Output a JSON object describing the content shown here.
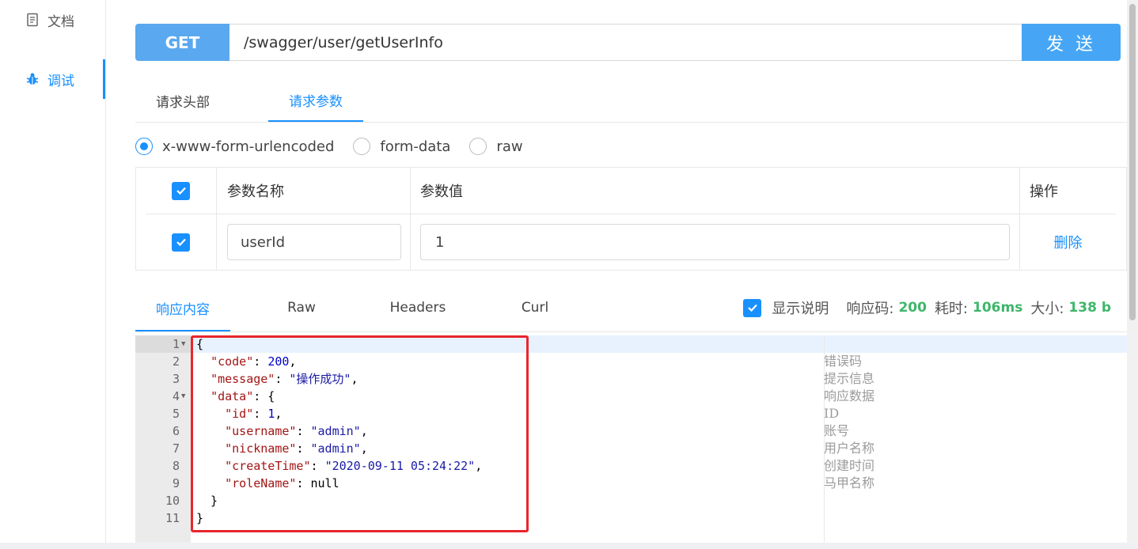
{
  "sidebar": {
    "items": [
      {
        "label": "文档",
        "icon": "document-icon"
      },
      {
        "label": "调试",
        "icon": "bug-icon"
      }
    ]
  },
  "request": {
    "method": "GET",
    "url": "/swagger/user/getUserInfo",
    "send_label": "发 送"
  },
  "tabs": [
    {
      "label": "请求头部"
    },
    {
      "label": "请求参数"
    }
  ],
  "body_types": [
    {
      "label": "x-www-form-urlencoded",
      "selected": true
    },
    {
      "label": "form-data",
      "selected": false
    },
    {
      "label": "raw",
      "selected": false
    }
  ],
  "params_table": {
    "headers": [
      "参数名称",
      "参数值",
      "操作"
    ],
    "rows": [
      {
        "checked": true,
        "name": "userId",
        "value": "1",
        "action": "删除"
      }
    ]
  },
  "response_tabs": [
    {
      "label": "响应内容"
    },
    {
      "label": "Raw"
    },
    {
      "label": "Headers"
    },
    {
      "label": "Curl"
    }
  ],
  "response_meta": {
    "show_desc_label": "显示说明",
    "show_desc_checked": true,
    "status_label": "响应码:",
    "status_value": "200",
    "time_label": "耗时:",
    "time_value": "106ms",
    "size_label": "大小:",
    "size_value": "138 b"
  },
  "response_code": {
    "lines": [
      {
        "n": "1",
        "fold": true
      },
      {
        "n": "2",
        "fold": false
      },
      {
        "n": "3",
        "fold": false
      },
      {
        "n": "4",
        "fold": true
      },
      {
        "n": "5",
        "fold": false
      },
      {
        "n": "6",
        "fold": false
      },
      {
        "n": "7",
        "fold": false
      },
      {
        "n": "8",
        "fold": false
      },
      {
        "n": "9",
        "fold": false
      },
      {
        "n": "10",
        "fold": false
      },
      {
        "n": "11",
        "fold": false
      }
    ],
    "keys": {
      "code": "\"code\"",
      "message": "\"message\"",
      "data": "\"data\"",
      "id": "\"id\"",
      "username": "\"username\"",
      "nickname": "\"nickname\"",
      "createTime": "\"createTime\"",
      "roleName": "\"roleName\""
    },
    "values": {
      "code": "200",
      "message": "\"操作成功\"",
      "id": "1",
      "username": "\"admin\"",
      "nickname": "\"admin\"",
      "createTime": "\"2020-09-11 05:24:22\"",
      "roleName": "null"
    },
    "descriptions": [
      "错误码",
      "提示信息",
      "响应数据",
      "ID",
      "账号",
      "用户名称",
      "创建时间",
      "马甲名称"
    ]
  },
  "colors": {
    "accent": "#1890ff",
    "method_bg": "#5aa8f0",
    "send_bg": "#46a6f5",
    "success": "#3fb66b",
    "highlight_border": "#e8262b"
  }
}
